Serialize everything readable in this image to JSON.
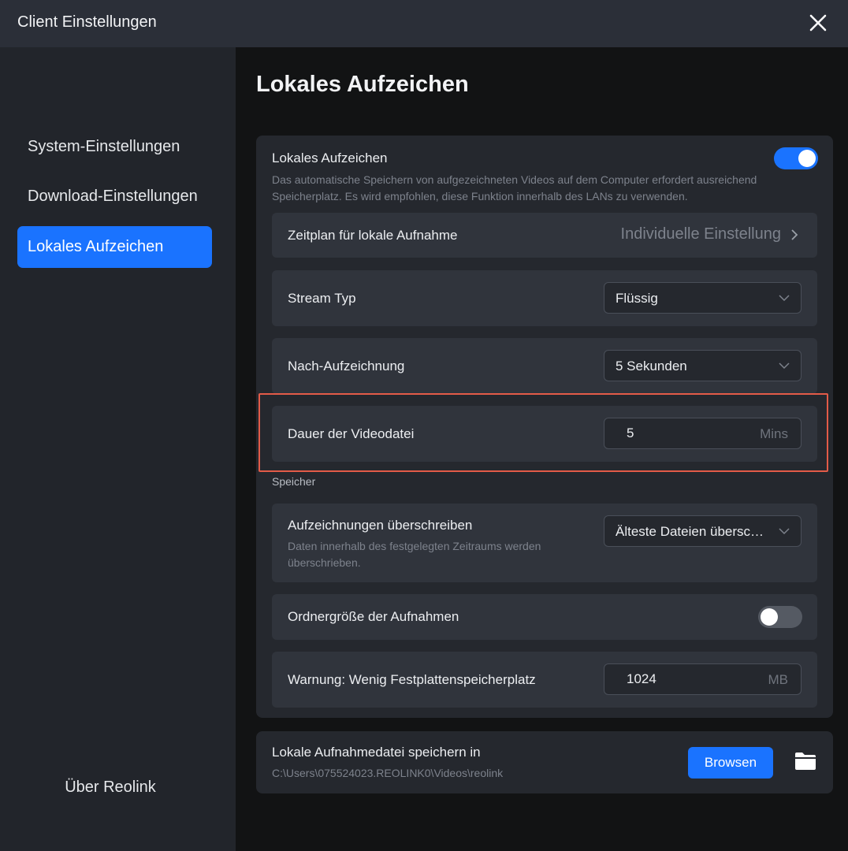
{
  "window": {
    "title": "Client Einstellungen",
    "close_icon": "close-icon"
  },
  "sidebar": {
    "items": [
      {
        "label": "System-Einstellungen",
        "active": false
      },
      {
        "label": "Download-Einstellungen",
        "active": false
      },
      {
        "label": "Lokales Aufzeichen",
        "active": true
      }
    ],
    "about": "Über Reolink"
  },
  "main": {
    "title": "Lokales Aufzeichen",
    "local_recording": {
      "label": "Lokales Aufzeichen",
      "enabled": true,
      "description": "Das automatische Speichern von aufgezeichneten Videos auf dem Computer erfordert ausreichend Speicherplatz. Es wird empfohlen, diese Funktion innerhalb des LANs zu verwenden."
    },
    "schedule": {
      "label": "Zeitplan für lokale Aufnahme",
      "value": "Individuelle Einstellung"
    },
    "stream_type": {
      "label": "Stream Typ",
      "value": "Flüssig"
    },
    "post_recording": {
      "label": "Nach-Aufzeichnung",
      "value": "5 Sekunden"
    },
    "file_duration": {
      "label": "Dauer der Videodatei",
      "value": "5",
      "unit": "Mins"
    },
    "storage": {
      "section_label": "Speicher",
      "overwrite": {
        "label": "Aufzeichnungen überschreiben",
        "description": "Daten innerhalb des festgelegten Zeitraums werden überschrieben.",
        "value": "Älteste Dateien überschreiben"
      },
      "folder_size": {
        "label": "Ordnergröße der Aufnahmen",
        "enabled": false
      },
      "low_disk_warning": {
        "label": "Warnung: Wenig Festplattenspeicherplatz",
        "value": "1024",
        "unit": "MB"
      }
    },
    "save_path": {
      "label": "Lokale Aufnahmedatei speichern in",
      "path": "C:\\Users\\075524023.REOLINK0\\Videos\\reolink",
      "browse_label": "Browsen"
    }
  },
  "colors": {
    "accent": "#1a73ff",
    "highlight_border": "#e35b48"
  }
}
